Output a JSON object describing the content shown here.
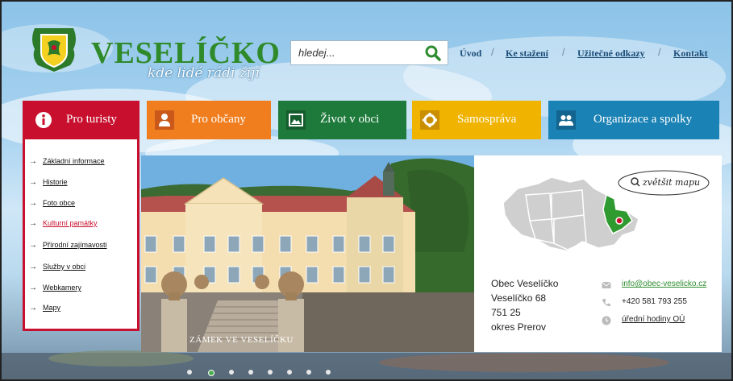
{
  "header": {
    "brand": "VESELÍČKO",
    "tagline": "kde lidé rádi žijí",
    "search_placeholder": "hledej...",
    "top_links": [
      "Úvod",
      "Ke stažení",
      "Užitečné odkazy",
      "Kontakt"
    ]
  },
  "main_menu": [
    {
      "label": "Pro turisty",
      "icon": "info-icon",
      "color": "#c8102e"
    },
    {
      "label": "Pro občany",
      "icon": "person-icon",
      "color": "#f07e1f"
    },
    {
      "label": "Život v obci",
      "icon": "image-icon",
      "color": "#1d7a3b"
    },
    {
      "label": "Samospráva",
      "icon": "gear-icon",
      "color": "#efb300"
    },
    {
      "label": "Organizace a spolky",
      "icon": "people-icon",
      "color": "#1a82b4"
    }
  ],
  "dropdown": {
    "items": [
      "Základní informace",
      "Historie",
      "Foto obce",
      "Kulturní památky",
      "Přírodní zajímavosti",
      "Služby v obci",
      "Webkamery",
      "Mapy"
    ],
    "active_color": "#c8102e"
  },
  "slider": {
    "caption": "ZÁMEK VE VESELÍČKU"
  },
  "info": {
    "map_button": "zvětšit mapu",
    "address": [
      "Obec Veselíčko",
      "Veselíčko 68",
      "751 25",
      "okres Prerov"
    ],
    "email": "info@obec-veselicko.cz",
    "phone": "+420 581 793 255",
    "hours": "úřední hodiny OÚ"
  }
}
